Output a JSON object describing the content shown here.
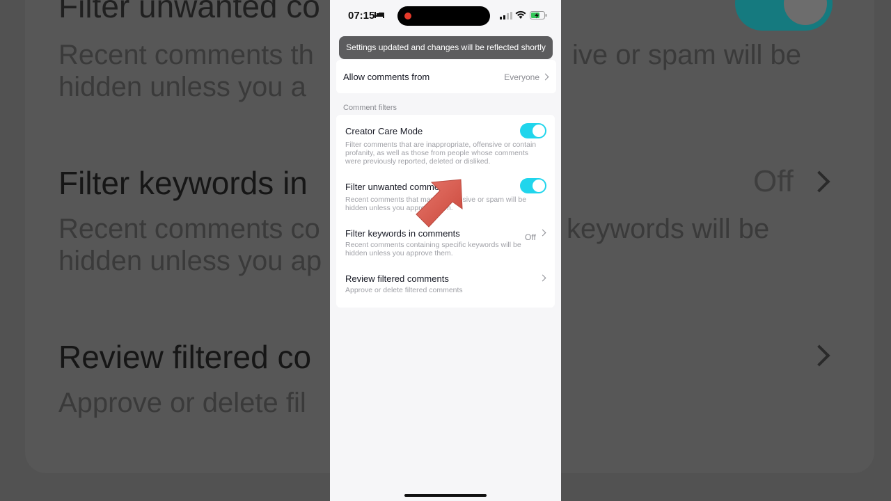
{
  "status_bar": {
    "time": "07:15"
  },
  "toast": {
    "message": "Settings updated and changes will be reflected shortly"
  },
  "allow_comments": {
    "label": "Allow comments from",
    "value": "Everyone"
  },
  "section": {
    "label": "Comment filters"
  },
  "filters": [
    {
      "title": "Creator Care Mode",
      "description": "Filter comments that are inappropriate, offensive or contain profanity, as well as those from people whose comments were previously reported, deleted or disliked.",
      "toggle_on": true
    },
    {
      "title": "Filter unwanted comments",
      "description": "Recent comments that may be offensive or spam will be hidden unless you approve them.",
      "toggle_on": true
    },
    {
      "title": "Filter keywords in comments",
      "description": "Recent comments containing specific keywords will be hidden unless you approve them.",
      "value": "Off"
    },
    {
      "title": "Review filtered comments",
      "description": "Approve or delete filtered comments"
    }
  ],
  "background": {
    "title_top": "Filter unwanted co",
    "desc1_line1": "Recent comments th",
    "desc1_line1_right": "ive or spam will be",
    "desc1_line2": "hidden unless you a",
    "title_keywords": "Filter keywords in",
    "off": "Off",
    "desc2_line1": "Recent comments co",
    "desc2_line1_right": "keywords will be",
    "desc2_line2": "hidden unless you ap",
    "title_review": "Review filtered co",
    "desc3": "Approve or delete fil"
  },
  "colors": {
    "accent": "#20d5ec",
    "toast_bg": "#5c5c5e",
    "arrow": "#d9574a"
  }
}
